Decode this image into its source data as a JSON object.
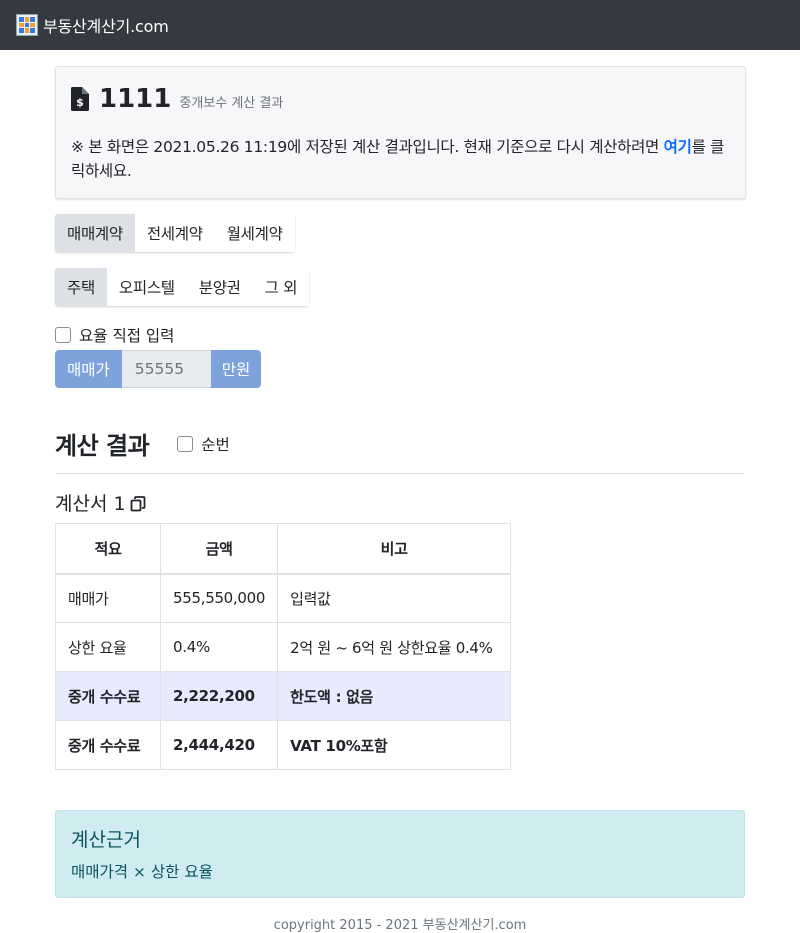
{
  "brand": {
    "name": "부동산계산기.com",
    "icon": "calculator-logo-icon"
  },
  "saved": {
    "number": "1111",
    "subtitle": "중개보수 계산 결과",
    "notice_prefix": "※ 본 화면은 2021.05.26 11:19에 저장된 계산 결과입니다. 현재 기준으로 다시 계산하려면 ",
    "notice_link": "여기",
    "notice_suffix": "를 클릭하세요.",
    "icon": "file-invoice-dollar-icon"
  },
  "contract_types": [
    {
      "label": "매매계약",
      "active": true
    },
    {
      "label": "전세계약",
      "active": false
    },
    {
      "label": "월세계약",
      "active": false
    }
  ],
  "property_types": [
    {
      "label": "주택",
      "active": true
    },
    {
      "label": "오피스텔",
      "active": false
    },
    {
      "label": "분양권",
      "active": false
    },
    {
      "label": "그 외",
      "active": false
    }
  ],
  "direct_rate": {
    "label": "요율 직접 입력",
    "checked": false
  },
  "price_input": {
    "prefix": "매매가",
    "value": "55555",
    "suffix": "만원"
  },
  "result": {
    "title": "계산 결과",
    "seq_label": "순번",
    "sheet_title": "계산서 1"
  },
  "table": {
    "headers": [
      "적요",
      "금액",
      "비고"
    ],
    "rows": [
      [
        "매매가",
        "555,550,000",
        "입력값"
      ],
      [
        "상한 요율",
        "0.4%",
        "2억 원 ~ 6억 원 상한요율 0.4%"
      ],
      [
        "중개 수수료",
        "2,222,200",
        "한도액 : 없음"
      ],
      [
        "중개 수수료",
        "2,444,420",
        "VAT 10%포함"
      ]
    ]
  },
  "basis": {
    "title": "계산근거",
    "formula": "매매가격 × 상한 요율"
  },
  "footer": {
    "text": "copyright 2015 - 2021 부동산계산기.com"
  },
  "colors": {
    "navbar": "#343a40",
    "accent": "#7ea3dc",
    "link": "#0d6efd",
    "highlight_row": "#e8ebfd",
    "info_bg": "#d1ecf1"
  }
}
